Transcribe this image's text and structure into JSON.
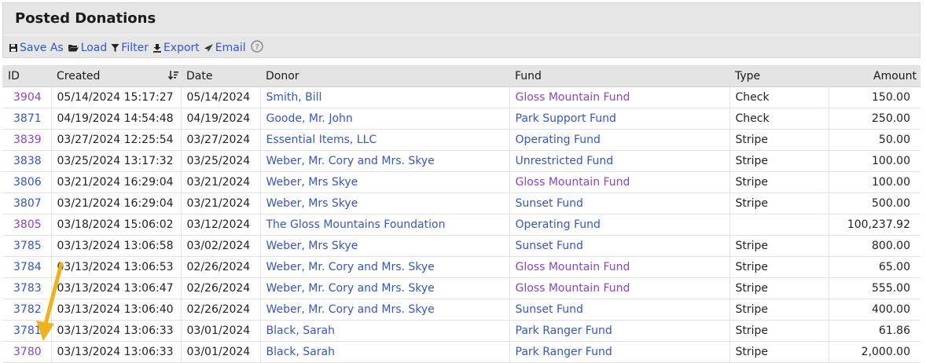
{
  "panel": {
    "title": "Posted Donations",
    "toolbar": {
      "save_as": "Save As",
      "load": "Load",
      "filter": "Filter",
      "export": "Export",
      "email": "Email",
      "help": "?"
    }
  },
  "table": {
    "columns": [
      "ID",
      "Created",
      "Date",
      "Donor",
      "Fund",
      "Type",
      "Amount"
    ],
    "sorted_column": "Created",
    "rows": [
      {
        "id": "3904",
        "created": "05/14/2024 15:17:27",
        "date": "05/14/2024",
        "donor": "Smith, Bill",
        "fund": "Gloss Mountain Fund",
        "type": "Check",
        "amount": "150.00",
        "id_visited": true,
        "fund_visited": true
      },
      {
        "id": "3871",
        "created": "04/19/2024 14:54:48",
        "date": "04/19/2024",
        "donor": "Goode, Mr. John",
        "fund": "Park Support Fund",
        "type": "Check",
        "amount": "250.00",
        "id_visited": false,
        "fund_visited": false
      },
      {
        "id": "3839",
        "created": "03/27/2024 12:25:54",
        "date": "03/27/2024",
        "donor": "Essential Items, LLC",
        "fund": "Operating Fund",
        "type": "Stripe",
        "amount": "50.00",
        "id_visited": true,
        "fund_visited": false
      },
      {
        "id": "3838",
        "created": "03/25/2024 13:17:32",
        "date": "03/25/2024",
        "donor": "Weber, Mr. Cory and Mrs. Skye",
        "fund": "Unrestricted Fund",
        "type": "Stripe",
        "amount": "100.00",
        "id_visited": false,
        "fund_visited": false
      },
      {
        "id": "3806",
        "created": "03/21/2024 16:29:04",
        "date": "03/21/2024",
        "donor": "Weber, Mrs Skye",
        "fund": "Gloss Mountain Fund",
        "type": "Stripe",
        "amount": "100.00",
        "id_visited": false,
        "fund_visited": true
      },
      {
        "id": "3807",
        "created": "03/21/2024 16:29:04",
        "date": "03/21/2024",
        "donor": "Weber, Mrs Skye",
        "fund": "Sunset Fund",
        "type": "Stripe",
        "amount": "500.00",
        "id_visited": false,
        "fund_visited": false
      },
      {
        "id": "3805",
        "created": "03/18/2024 15:06:02",
        "date": "03/12/2024",
        "donor": "The Gloss Mountains Foundation",
        "fund": "Operating Fund",
        "type": "",
        "amount": "100,237.92",
        "id_visited": true,
        "fund_visited": false
      },
      {
        "id": "3785",
        "created": "03/13/2024 13:06:58",
        "date": "03/02/2024",
        "donor": "Weber, Mrs Skye",
        "fund": "Sunset Fund",
        "type": "Stripe",
        "amount": "800.00",
        "id_visited": false,
        "fund_visited": false
      },
      {
        "id": "3784",
        "created": "03/13/2024 13:06:53",
        "date": "02/26/2024",
        "donor": "Weber, Mr. Cory and Mrs. Skye",
        "fund": "Gloss Mountain Fund",
        "type": "Stripe",
        "amount": "65.00",
        "id_visited": false,
        "fund_visited": true
      },
      {
        "id": "3783",
        "created": "03/13/2024 13:06:47",
        "date": "02/26/2024",
        "donor": "Weber, Mr. Cory and Mrs. Skye",
        "fund": "Gloss Mountain Fund",
        "type": "Stripe",
        "amount": "555.00",
        "id_visited": false,
        "fund_visited": true
      },
      {
        "id": "3782",
        "created": "03/13/2024 13:06:40",
        "date": "02/26/2024",
        "donor": "Weber, Mr. Cory and Mrs. Skye",
        "fund": "Sunset Fund",
        "type": "Stripe",
        "amount": "400.00",
        "id_visited": false,
        "fund_visited": false
      },
      {
        "id": "3781",
        "created": "03/13/2024 13:06:33",
        "date": "03/01/2024",
        "donor": "Black, Sarah",
        "fund": "Park Ranger Fund",
        "type": "Stripe",
        "amount": "61.86",
        "id_visited": false,
        "fund_visited": false
      },
      {
        "id": "3780",
        "created": "03/13/2024 13:06:33",
        "date": "03/01/2024",
        "donor": "Black, Sarah",
        "fund": "Park Ranger Fund",
        "type": "Stripe",
        "amount": "2,000.00",
        "id_visited": true,
        "fund_visited": false
      }
    ]
  },
  "colors": {
    "link": "#3355cc",
    "visited_link": "#8844cc",
    "arrow": "#f0b21a"
  }
}
